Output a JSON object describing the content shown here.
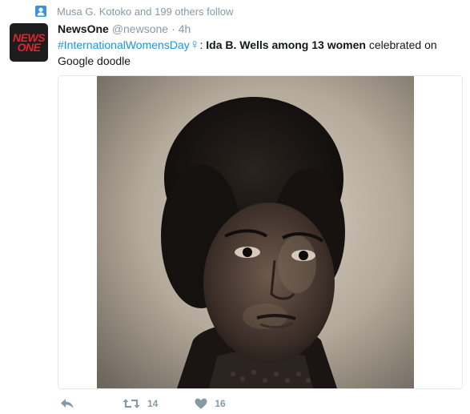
{
  "context": {
    "text": "Musa G. Kotoko and 199 others follow",
    "icon": "person-icon"
  },
  "author": {
    "avatar_line1": "NEWS",
    "avatar_line2": "ONE",
    "fullname": "NewsOne",
    "handle": "@newsone",
    "separator": "·",
    "time": "4h"
  },
  "tweet": {
    "hashtag": "#InternationalWomensDay",
    "female_sign": "♀",
    "after_sign": ": ",
    "bold_text": "Ida B. Wells among 13 women",
    "rest_text": " celebrated on Google doodle"
  },
  "actions": {
    "reply_icon": "reply-icon",
    "retweet_icon": "retweet-icon",
    "retweet_count": "14",
    "like_icon": "heart-icon",
    "like_count": "16"
  },
  "colors": {
    "link": "#1b95e0",
    "muted": "#8899a6",
    "text": "#14171a",
    "brand": "#e52330"
  }
}
